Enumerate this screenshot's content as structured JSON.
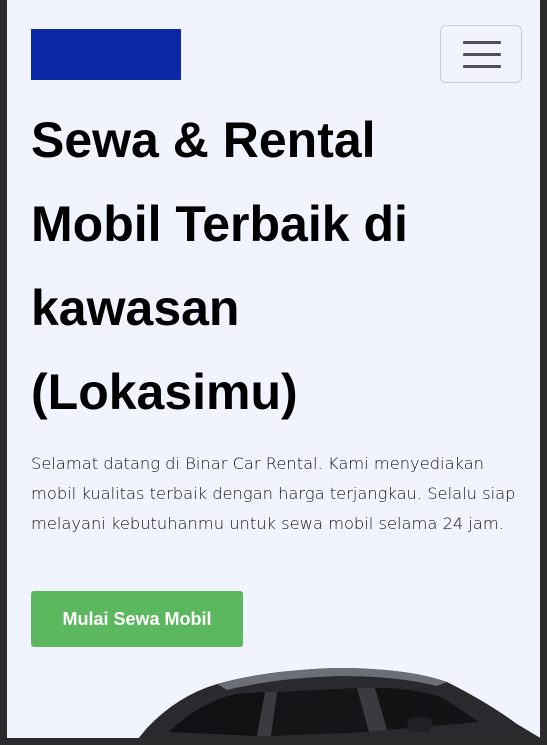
{
  "header": {
    "logo_color": "#0D28A6",
    "menu_icon": "hamburger-menu-icon"
  },
  "hero": {
    "headline": "Sewa & Rental Mobil Terbaik di kawasan (Lokasimu)",
    "description": "Selamat datang di Binar Car Rental. Kami menyediakan mobil kualitas terbaik dengan harga terjangkau. Selalu siap melayani kebutuhanmu untuk sewa mobil selama 24 jam.",
    "cta_label": "Mulai Sewa Mobil",
    "cta_color": "#5CB85F",
    "background_color": "#F1F3FF",
    "image": "car-image"
  }
}
